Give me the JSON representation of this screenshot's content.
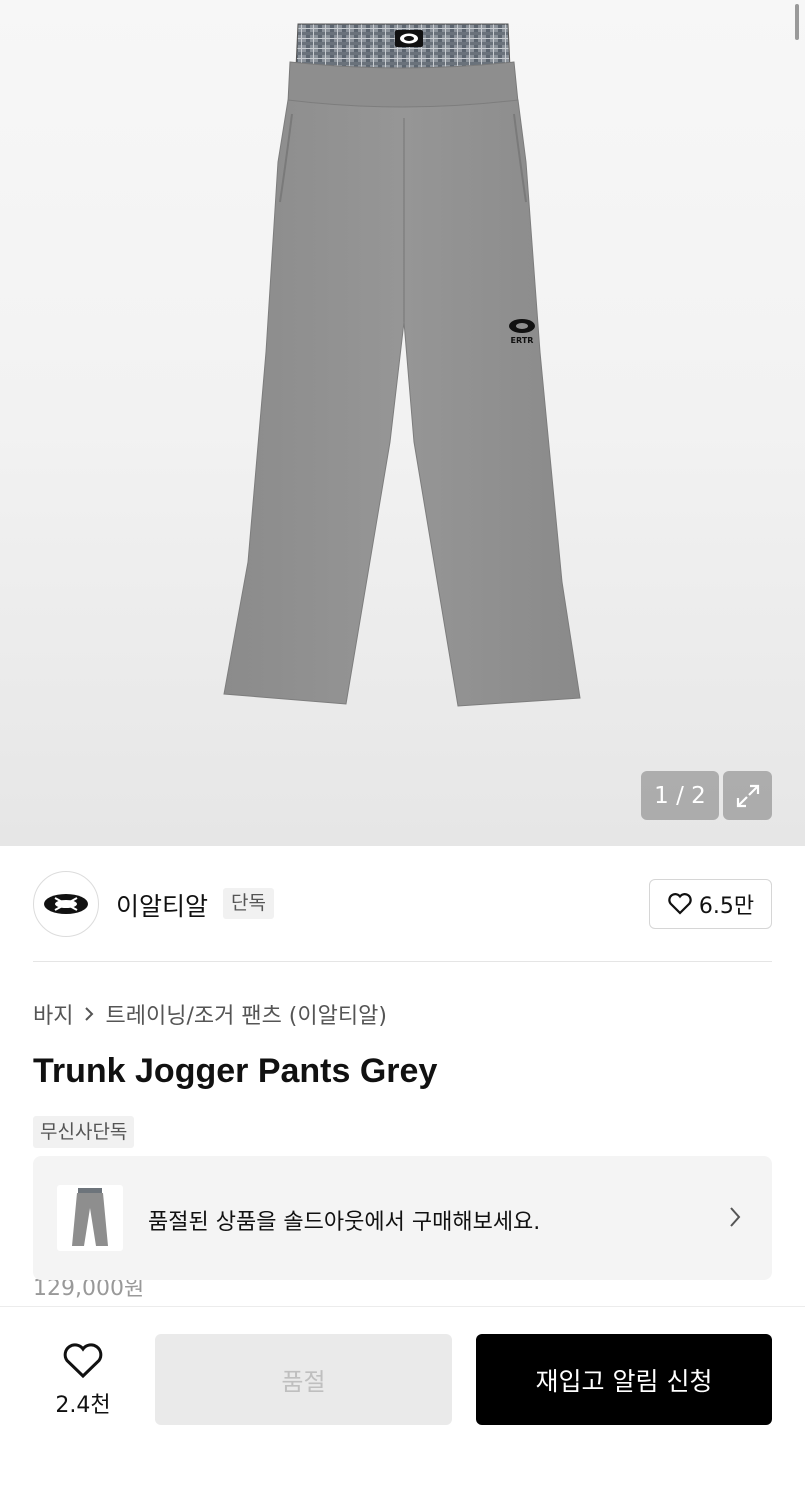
{
  "gallery": {
    "counter": "1 / 2",
    "image_alt": "grey jogger pants with checked boxer waistband",
    "waistband_logo": "ERTR"
  },
  "brand": {
    "name": "이알티알",
    "tag": "단독",
    "likes": "6.5만",
    "logo_icon": "ertr-logo-icon"
  },
  "breadcrumb": {
    "category": "바지",
    "subcategory": "트레이닝/조거 팬츠 (이알티알)"
  },
  "product": {
    "title": "Trunk Jogger Pants Grey",
    "badge": "무신사단독",
    "price_partial": "129,000원"
  },
  "soldout_card": {
    "text": "품절된 상품을 솔드아웃에서 구매해보세요."
  },
  "bottom_bar": {
    "wish_count": "2.4천",
    "soldout_label": "품절",
    "restock_label": "재입고 알림 신청"
  },
  "colors": {
    "primary_button": "#000000",
    "disabled_button": "#eaeaea",
    "tag_bg": "#f1f1f1"
  }
}
